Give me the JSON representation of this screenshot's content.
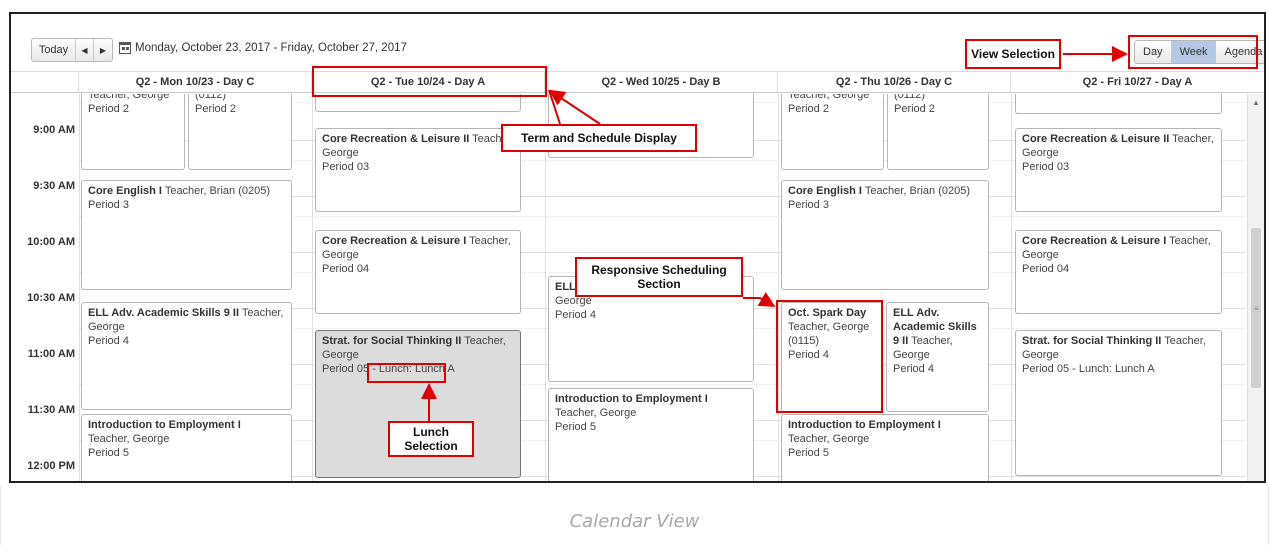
{
  "toolbar": {
    "today_label": "Today",
    "prev_icon": "◀",
    "next_icon": "▶",
    "date_range": "Monday, October 23, 2017 - Friday, October 27, 2017",
    "views": [
      "Day",
      "Week",
      "Agenda"
    ],
    "active_view": "Week"
  },
  "days": [
    "Q2 - Mon 10/23 - Day C",
    "Q2 - Tue 10/24 - Day A",
    "Q2 - Wed 10/25 - Day B",
    "Q2 - Thu 10/26 - Day C",
    "Q2 - Fri 10/27 - Day A"
  ],
  "times": [
    "9:00 AM",
    "9:30 AM",
    "10:00 AM",
    "10:30 AM",
    "11:00 AM",
    "11:30 AM",
    "12:00 PM"
  ],
  "events": {
    "mon_1a": {
      "title": "",
      "line1": "Teacher, George",
      "line2": "Period 2"
    },
    "mon_1b": {
      "title": "",
      "line1": "(0112)",
      "line2": "Period 2"
    },
    "mon_2": {
      "title": "Core English I",
      "line1": " Teacher, Brian (0205)",
      "line2": "Period 3"
    },
    "mon_3": {
      "title": "ELL Adv. Academic Skills 9 II",
      "line1": " Teacher, George",
      "line2": "Period 4"
    },
    "mon_4": {
      "title": "Introduction to Employment I",
      "line1": " Teacher, George",
      "line2": "Period 5"
    },
    "tue_2": {
      "title": "Core Recreation & Leisure II",
      "line1": " Teacher, George",
      "line2": "Period 03"
    },
    "tue_3": {
      "title": "Core Recreation & Leisure I",
      "line1": " Teacher, George",
      "line2": "Period 04"
    },
    "tue_4": {
      "title": "Strat. for Social Thinking II",
      "line1": " Teacher, George",
      "line2a": "Period 05 - ",
      "line2b": "Lunch: Lunch A"
    },
    "wed_3": {
      "title": "ELL",
      "line1": "George",
      "line2": "Period 4"
    },
    "wed_4": {
      "title": "Introduction to Employment I",
      "line1": " Teacher, George",
      "line2": "Period 5"
    },
    "thu_1a": {
      "title": "",
      "line1": "Teacher, George",
      "line2": "Period 2"
    },
    "thu_1b": {
      "title": "",
      "line1": "(0112)",
      "line2": "Period 2"
    },
    "thu_2": {
      "title": "Core English I",
      "line1": " Teacher, Brian (0205)",
      "line2": "Period 3"
    },
    "thu_3a": {
      "title": "Oct. Spark Day",
      "line1": "Teacher, George (0115)",
      "line2": "Period 4"
    },
    "thu_3b": {
      "title": "ELL Adv. Academic Skills 9 II",
      "line1": " Teacher, George",
      "line2": "Period 4"
    },
    "thu_4": {
      "title": "Introduction to Employment I",
      "line1": " Teacher, George",
      "line2": "Period 5"
    },
    "fri_2": {
      "title": "Core Recreation & Leisure II",
      "line1": " Teacher, George",
      "line2": "Period 03"
    },
    "fri_3": {
      "title": "Core Recreation & Leisure I",
      "line1": " Teacher, George",
      "line2": "Period 04"
    },
    "fri_4": {
      "title": "Strat. for Social Thinking II",
      "line1": " Teacher, George",
      "line2": "Period 05 - Lunch: Lunch A"
    }
  },
  "annotations": {
    "view_selection": "View Selection",
    "term_schedule": "Term and Schedule Display",
    "responsive": "Responsive Scheduling Section",
    "lunch": "Lunch Selection"
  },
  "caption": "Calendar View",
  "colors": {
    "accent": "#e00000",
    "active_view": "#b5c9e4",
    "selected_event": "#dcdcdc"
  }
}
